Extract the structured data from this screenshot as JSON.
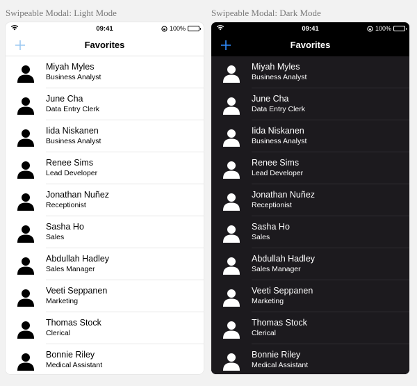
{
  "captions": {
    "light": "Swipeable Modal: Light Mode",
    "dark": "Swipeable Modal: Dark Mode"
  },
  "status_bar": {
    "time": "09:41",
    "battery": "100%"
  },
  "navbar": {
    "title": "Favorites",
    "add_icon": "plus-icon"
  },
  "colors": {
    "light_accent": "#9cc8f2",
    "dark_accent": "#2f8cff",
    "dark_background": "#1c1a1e",
    "battery_green": "#4cd964"
  },
  "contacts": [
    {
      "name": "Miyah Myles",
      "title": "Business Analyst"
    },
    {
      "name": "June Cha",
      "title": "Data Entry Clerk"
    },
    {
      "name": "Iida Niskanen",
      "title": "Business Analyst"
    },
    {
      "name": "Renee Sims",
      "title": "Lead Developer"
    },
    {
      "name": "Jonathan Nuñez",
      "title": "Receptionist"
    },
    {
      "name": "Sasha Ho",
      "title": "Sales"
    },
    {
      "name": "Abdullah Hadley",
      "title": "Sales Manager"
    },
    {
      "name": "Veeti Seppanen",
      "title": "Marketing"
    },
    {
      "name": "Thomas Stock",
      "title": "Clerical"
    },
    {
      "name": "Bonnie Riley",
      "title": "Medical Assistant"
    }
  ]
}
